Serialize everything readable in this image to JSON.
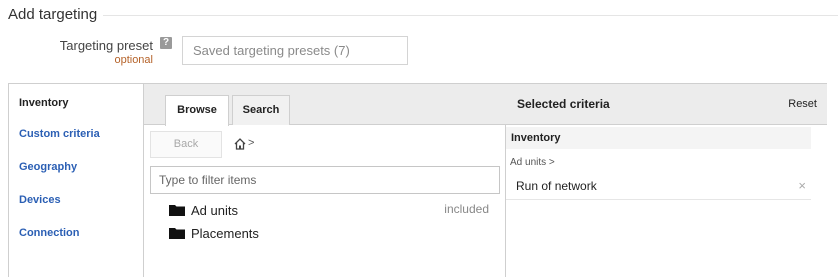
{
  "section": {
    "title": "Add targeting"
  },
  "preset": {
    "label": "Targeting preset",
    "optional": "optional",
    "help_icon": "?",
    "placeholder": "Saved targeting presets (7)"
  },
  "nav": {
    "items": [
      {
        "label": "Inventory",
        "active": true
      },
      {
        "label": "Custom criteria",
        "active": false
      },
      {
        "label": "Geography",
        "active": false
      },
      {
        "label": "Devices",
        "active": false
      },
      {
        "label": "Connection",
        "active": false
      }
    ]
  },
  "browser": {
    "tabs": [
      {
        "label": "Browse",
        "active": true
      },
      {
        "label": "Search",
        "active": false
      }
    ],
    "back_label": "Back",
    "breadcrumb_icon": "home-icon",
    "breadcrumb_sep": ">",
    "filter_placeholder": "Type to filter items",
    "tree": [
      {
        "label": "Ad units",
        "status": "included",
        "icon": "folder-icon"
      },
      {
        "label": "Placements",
        "status": "",
        "icon": "folder-icon"
      }
    ]
  },
  "selected": {
    "title": "Selected criteria",
    "reset_label": "Reset",
    "group_label": "Inventory",
    "path": "Ad units >",
    "items": [
      {
        "label": "Run of network",
        "remove": "×"
      }
    ]
  },
  "colors": {
    "link": "#2b5fb4",
    "optional": "#b5632a",
    "header_bg": "#ececec",
    "border": "#cfcfcf"
  }
}
